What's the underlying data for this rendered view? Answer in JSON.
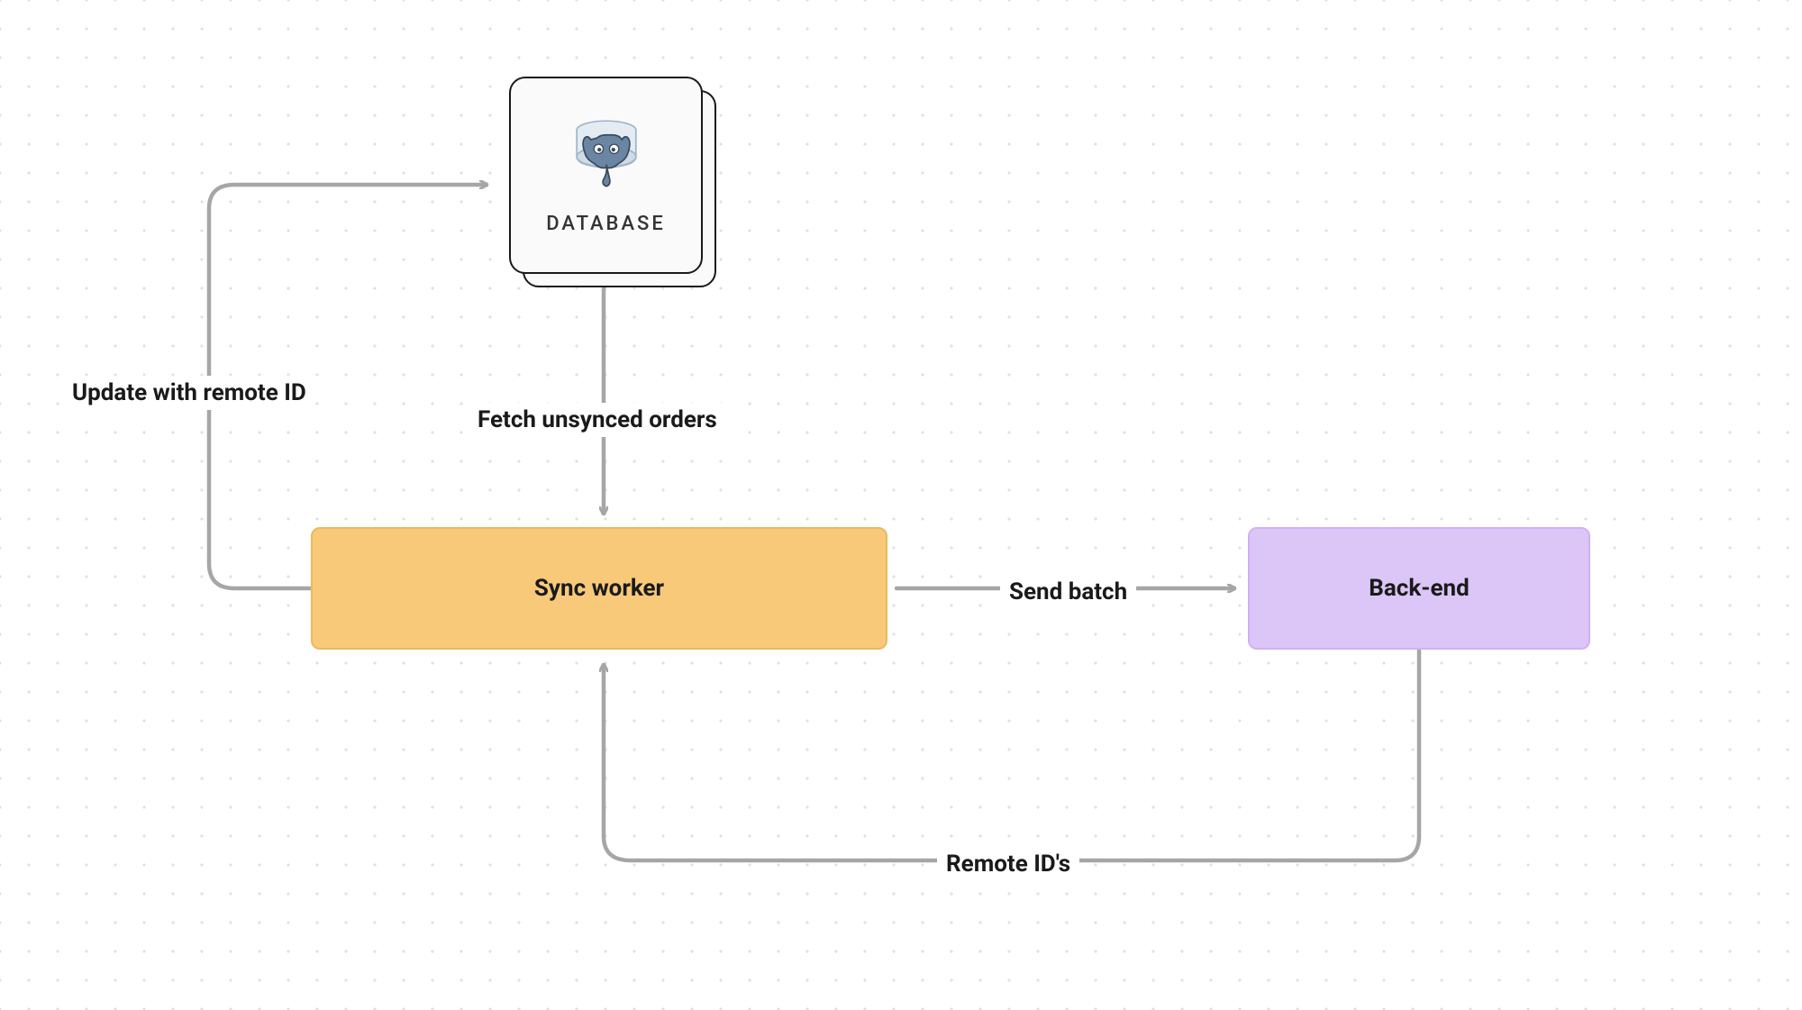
{
  "nodes": {
    "database": {
      "label": "DATABASE"
    },
    "sync_worker": {
      "label": "Sync worker"
    },
    "backend": {
      "label": "Back-end"
    }
  },
  "edges": {
    "update_remote_id": {
      "label": "Update with remote ID"
    },
    "fetch_unsynced": {
      "label": "Fetch unsynced orders"
    },
    "send_batch": {
      "label": "Send batch"
    },
    "remote_ids": {
      "label": "Remote ID's"
    }
  }
}
